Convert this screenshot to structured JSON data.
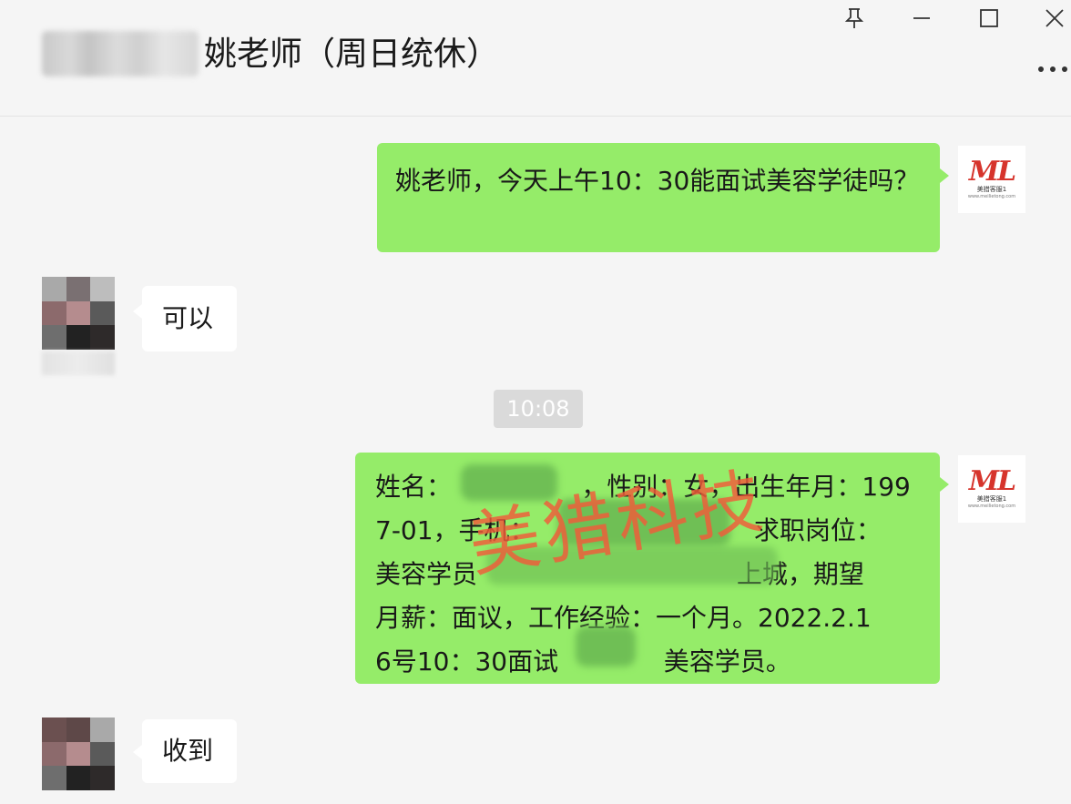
{
  "header": {
    "contact_title": "姚老师（周日统休）",
    "pin_icon": "pin-icon",
    "minimize_icon": "minimize-icon",
    "maximize_icon": "maximize-icon",
    "close_icon": "close-icon",
    "more_icon": "more-icon"
  },
  "colors": {
    "background": "#f5f5f5",
    "sent_bubble": "#95ec69",
    "received_bubble": "#ffffff",
    "watermark": "#f25c3a",
    "brand_red": "#d6342c"
  },
  "brand_avatar": {
    "logo_text": "ML",
    "sub_text": "美猎客服1",
    "url_text": "www.meilietong.com"
  },
  "messages": [
    {
      "direction": "sent",
      "text": "姚老师，今天上午10：30能面试美容学徒吗？"
    },
    {
      "direction": "received",
      "text": "可以"
    },
    {
      "direction": "timestamp",
      "text": "10:08"
    },
    {
      "direction": "sent",
      "lines": [
        "姓名：                ，性别：女，出生年月：199",
        "7-01，手机：                           求职岗位：",
        "美容学员                                上城，期望",
        "月薪：面议，工作经验：一个月。2022.2.1",
        "6号10：30面试             美容学员。"
      ]
    },
    {
      "direction": "received",
      "text": "收到"
    }
  ],
  "watermark": "美猎科技"
}
